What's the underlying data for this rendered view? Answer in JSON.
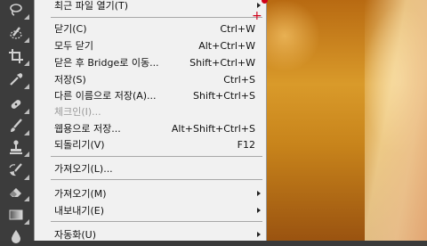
{
  "menu": {
    "items": [
      {
        "label": "최근 파일 열기(T)",
        "shortcut": "",
        "submenu": true,
        "disabled": false
      },
      {
        "label": "닫기(C)",
        "shortcut": "Ctrl+W",
        "submenu": false,
        "disabled": false
      },
      {
        "label": "모두 닫기",
        "shortcut": "Alt+Ctrl+W",
        "submenu": false,
        "disabled": false
      },
      {
        "label": "닫은 후 Bridge로 이동...",
        "shortcut": "Shift+Ctrl+W",
        "submenu": false,
        "disabled": false
      },
      {
        "label": "저장(S)",
        "shortcut": "Ctrl+S",
        "submenu": false,
        "disabled": false
      },
      {
        "label": "다른 이름으로 저장(A)...",
        "shortcut": "Shift+Ctrl+S",
        "submenu": false,
        "disabled": false
      },
      {
        "label": "체크인(I)...",
        "shortcut": "",
        "submenu": false,
        "disabled": true
      },
      {
        "label": "웹용으로 저장...",
        "shortcut": "Alt+Shift+Ctrl+S",
        "submenu": false,
        "disabled": false
      },
      {
        "label": "되돌리기(V)",
        "shortcut": "F12",
        "submenu": false,
        "disabled": false
      },
      {
        "label": "가져오기(L)...",
        "shortcut": "",
        "submenu": false,
        "disabled": false
      },
      {
        "label": "가져오기(M)",
        "shortcut": "",
        "submenu": true,
        "disabled": false
      },
      {
        "label": "내보내기(E)",
        "shortcut": "",
        "submenu": true,
        "disabled": false
      },
      {
        "label": "자동화(U)",
        "shortcut": "",
        "submenu": true,
        "disabled": false
      }
    ]
  },
  "tools": [
    {
      "icon": "lasso-icon"
    },
    {
      "icon": "quick-selection-icon"
    },
    {
      "icon": "crop-icon"
    },
    {
      "icon": "eyedropper-icon"
    },
    {
      "icon": "spot-healing-brush-icon"
    },
    {
      "icon": "brush-icon"
    },
    {
      "icon": "clone-stamp-icon"
    },
    {
      "icon": "history-brush-icon"
    },
    {
      "icon": "eraser-icon"
    },
    {
      "icon": "gradient-icon"
    },
    {
      "icon": "blur-icon"
    }
  ],
  "colors": {
    "menu_bg": "#f1f1f1",
    "toolbar_bg": "#3c3c3c",
    "marker": "#d0021b"
  }
}
